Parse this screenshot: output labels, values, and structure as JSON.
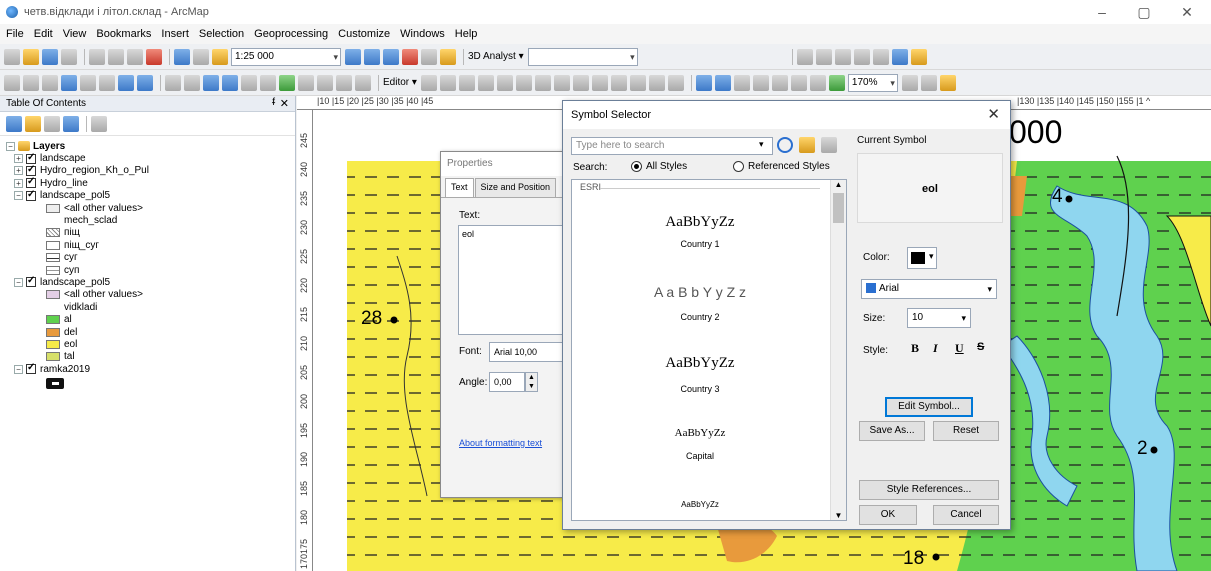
{
  "window": {
    "title": "четв.відклади і літол.склад - ArcMap",
    "minimize": "–",
    "maximize": "▢",
    "close": "✕"
  },
  "menu": [
    "File",
    "Edit",
    "View",
    "Bookmarks",
    "Insert",
    "Selection",
    "Geoprocessing",
    "Customize",
    "Windows",
    "Help"
  ],
  "toolbar": {
    "scale": "1:25 000",
    "analyst": "3D Analyst ▾",
    "editor": "Editor ▾",
    "zoom": "170%"
  },
  "toc": {
    "title": "Table Of Contents",
    "pin": "ᵮ",
    "close": "✕",
    "layers_root": "Layers",
    "items": [
      {
        "label": "landscape"
      },
      {
        "label": "Hydro_region_Kh_o_Pul"
      },
      {
        "label": "Hydro_line"
      },
      {
        "label": "landscape_pol5"
      },
      {
        "label": "<all other values>"
      },
      {
        "label": "mech_sclad"
      },
      {
        "label": "піщ"
      },
      {
        "label": "піщ_суг"
      },
      {
        "label": "суг"
      },
      {
        "label": "суп"
      },
      {
        "label": "landscape_pol5"
      },
      {
        "label": "<all other values>"
      },
      {
        "label": "vidkladi"
      },
      {
        "label": "al"
      },
      {
        "label": "del"
      },
      {
        "label": "eol"
      },
      {
        "label": "tal"
      },
      {
        "label": "ramka2019"
      }
    ]
  },
  "map": {
    "ruler_top": "|10  |15  |20  |25  |30  |35  |40  |45",
    "ruler_top_right": "|130  |135  |140  |145  |150  |155  |1 ^",
    "ruler_left": [
      "245",
      "240",
      "235",
      "230",
      "225",
      "220",
      "215",
      "210",
      "205",
      "200",
      "195",
      "190",
      "185",
      "180",
      "175",
      "170"
    ],
    "labels": [
      "28",
      "4",
      "2",
      "18"
    ],
    "scale_text": "000"
  },
  "properties": {
    "title": "Properties",
    "tab_text": "Text",
    "tab_size": "Size and Position",
    "text_label": "Text:",
    "text_value": "eol",
    "font_label": "Font:",
    "font_value": "Arial 10,00",
    "angle_label": "Angle:",
    "angle_value": "0,00",
    "link": "About formatting text"
  },
  "symbol_selector": {
    "title": "Symbol Selector",
    "search_placeholder": "Type here to search",
    "search_label": "Search:",
    "all_styles": "All Styles",
    "referenced_styles": "Referenced Styles",
    "group": "ESRI",
    "symbols": [
      {
        "sample": "AaBbYyZz",
        "name": "Country 1"
      },
      {
        "sample": "A a B b Y y Z z",
        "name": "Country 2"
      },
      {
        "sample": "AaBbYyZz",
        "name": "Country 3"
      },
      {
        "sample": "AaBbYyZz",
        "name": "Capital"
      },
      {
        "sample": "AaBbYyZz",
        "name": ""
      }
    ],
    "current_symbol_label": "Current Symbol",
    "current_symbol_preview": "eol",
    "color_label": "Color:",
    "font_value": "Arial",
    "size_label": "Size:",
    "size_value": "10",
    "style_label": "Style:",
    "bold": "B",
    "italic": "I",
    "underline": "U",
    "strike": "S",
    "edit_symbol": "Edit Symbol...",
    "save_as": "Save As...",
    "reset": "Reset",
    "style_references": "Style References...",
    "ok": "OK",
    "cancel": "Cancel"
  },
  "colors": {
    "map_yellow": "#f7eb49",
    "map_green": "#5fd14e",
    "map_water": "#8fd6ef",
    "map_orange": "#e89a3c"
  }
}
